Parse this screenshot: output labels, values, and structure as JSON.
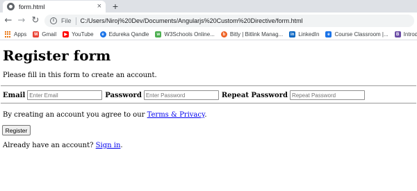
{
  "browser": {
    "tab_title": "form.html",
    "tab_close": "×",
    "new_tab": "+",
    "omnibox_label": "File",
    "url": "C:/Users/Niroj%20Dev/Documents/Angularjs%20Custom%20Directive/form.html",
    "bookmarks": [
      {
        "label": "Apps",
        "icon": "apps-grid-icon",
        "color": "#e8710a"
      },
      {
        "label": "Gmail",
        "icon": "gmail-icon",
        "color": "#ea4335"
      },
      {
        "label": "YouTube",
        "icon": "youtube-icon",
        "color": "#ff0000"
      },
      {
        "label": "Edureka Qandle",
        "icon": "edureka-icon",
        "color": "#1a73e8"
      },
      {
        "label": "W3Schools Online...",
        "icon": "w3schools-icon",
        "color": "#4caf50"
      },
      {
        "label": "Bitly | Bitlink Manag...",
        "icon": "bitly-icon",
        "color": "#ee6123"
      },
      {
        "label": "LinkedIn",
        "icon": "linkedin-icon",
        "color": "#0a66c2"
      },
      {
        "label": "Course Classroom |...",
        "icon": "course-icon",
        "color": "#1a73e8"
      },
      {
        "label": "Introd",
        "icon": "introd-icon",
        "color": "#6a4ca5"
      }
    ]
  },
  "page": {
    "title": "Register form",
    "intro": "Please fill in this form to create an account.",
    "fields": {
      "email_label": "Email",
      "email_placeholder": "Enter Email",
      "password_label": "Password",
      "password_placeholder": "Enter Password",
      "repeat_label": "Repeat Password",
      "repeat_placeholder": "Repeat Password"
    },
    "agree_text": "By creating an account you agree to our ",
    "terms_link": "Terms & Privacy",
    "agree_end": ".",
    "register_button": "Register",
    "signin_text": "Already have an account? ",
    "signin_link": "Sign in",
    "signin_end": "."
  }
}
